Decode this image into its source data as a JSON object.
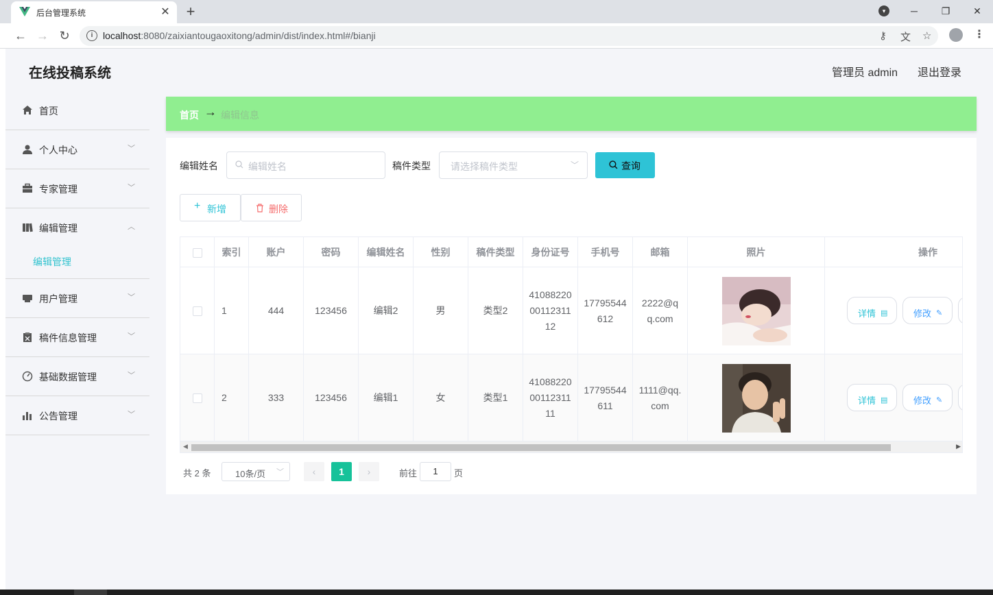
{
  "browser": {
    "tab_title": "后台管理系统",
    "tab_close": "✕",
    "new_tab": "+",
    "url_host": "localhost",
    "url_rest": ":8080/zaixiantougaoxitong/admin/dist/index.html#/bianji"
  },
  "header": {
    "app_title": "在线投稿系统",
    "user": "管理员 admin",
    "logout": "退出登录"
  },
  "sidebar": {
    "items": [
      {
        "label": "首页",
        "icon": "home-icon"
      },
      {
        "label": "个人中心",
        "icon": "user-icon"
      },
      {
        "label": "专家管理",
        "icon": "briefcase-icon"
      },
      {
        "label": "编辑管理",
        "icon": "book-icon"
      },
      {
        "label": "用户管理",
        "icon": "printer-icon"
      },
      {
        "label": "稿件信息管理",
        "icon": "clipboard-icon"
      },
      {
        "label": "基础数据管理",
        "icon": "gauge-icon"
      },
      {
        "label": "公告管理",
        "icon": "bar-chart-icon"
      }
    ],
    "sub_item": "编辑管理"
  },
  "breadcrumb": {
    "home": "首页",
    "sep": "→",
    "current": "编辑信息"
  },
  "search": {
    "name_label": "编辑姓名",
    "name_placeholder": "编辑姓名",
    "type_label": "稿件类型",
    "type_placeholder": "请选择稿件类型",
    "query_button": "查询"
  },
  "actions": {
    "add": "新增",
    "delete": "删除"
  },
  "table": {
    "headers": [
      "索引",
      "账户",
      "密码",
      "编辑姓名",
      "性别",
      "稿件类型",
      "身份证号",
      "手机号",
      "邮箱",
      "照片",
      "操作"
    ],
    "rows": [
      {
        "index": "1",
        "account": "444",
        "password": "123456",
        "name": "编辑2",
        "gender": "男",
        "type": "类型2",
        "id_card": "410882200011231112",
        "phone": "17795544612",
        "email": "2222@qq.com"
      },
      {
        "index": "2",
        "account": "333",
        "password": "123456",
        "name": "编辑1",
        "gender": "女",
        "type": "类型1",
        "id_card": "410882200011231111",
        "phone": "17795544611",
        "email": "1111@qq.com"
      }
    ],
    "detail_button": "详情",
    "edit_button": "修改"
  },
  "pagination": {
    "total": "共 2 条",
    "page_size": "10条/页",
    "current_page": "1",
    "goto_label": "前往",
    "goto_value": "1",
    "page_unit": "页"
  },
  "colors": {
    "accent": "#2ec3d6",
    "breadcrumb_bg": "#90ee90",
    "pager_active": "#16c29a",
    "delete": "#f56c6c"
  }
}
